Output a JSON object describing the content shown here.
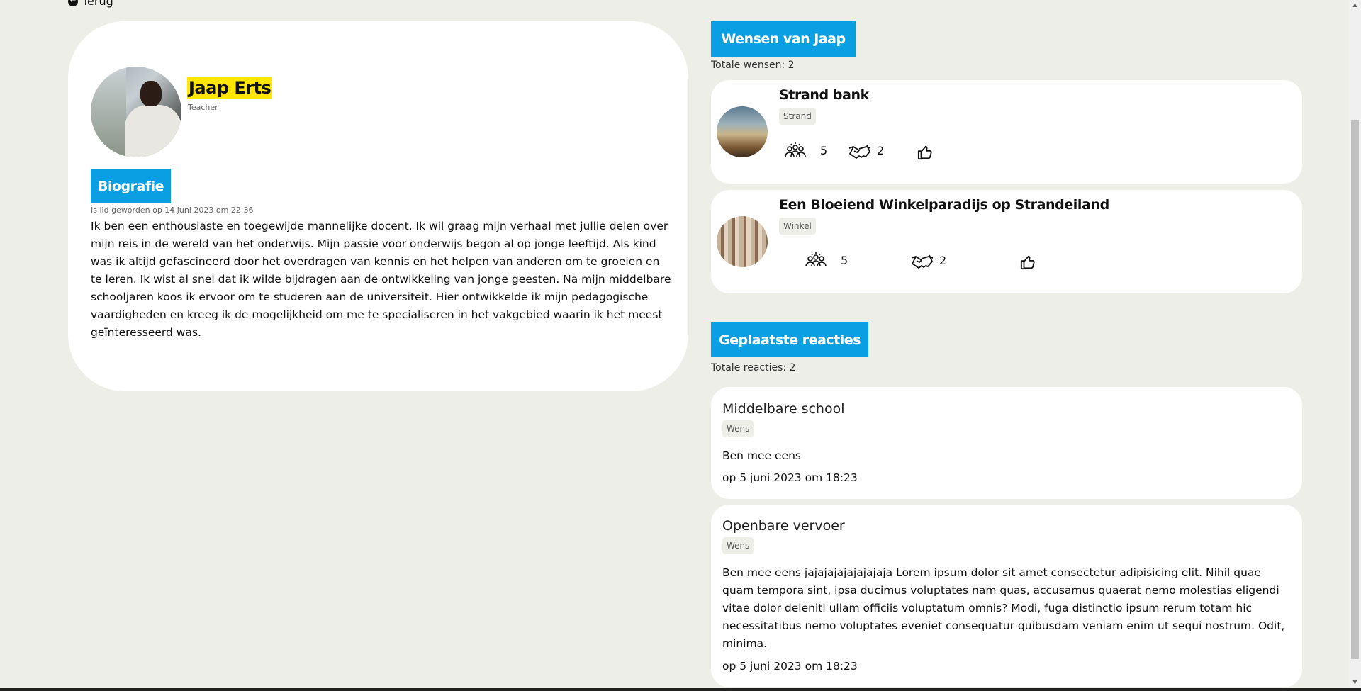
{
  "nav": {
    "back_label": "Terug"
  },
  "profile": {
    "name": "Jaap Erts",
    "role": "Teacher",
    "bio_heading": "Biografie",
    "member_since": "Is lid geworden op 14 juni 2023 om 22:36",
    "bio": "Ik ben een enthousiaste en toegewijde mannelijke docent. Ik wil graag mijn verhaal met jullie delen over mijn reis in de wereld van het onderwijs. Mijn passie voor onderwijs begon al op jonge leeftijd. Als kind was ik altijd gefascineerd door het overdragen van kennis en het helpen van anderen om te groeien en te leren. Ik wist al snel dat ik wilde bijdragen aan de ontwikkeling van jonge geesten. Na mijn middelbare schooljaren koos ik ervoor om te studeren aan de universiteit. Hier ontwikkelde ik mijn pedagogische vaardigheden en kreeg ik de mogelijkheid om me te specialiseren in het vakgebied waarin ik het meest geïnteresseerd was."
  },
  "wishes": {
    "heading": "Wensen van Jaap",
    "total": "Totale wensen: 2",
    "items": [
      {
        "title": "Strand bank",
        "tag": "Strand",
        "supporters": "5",
        "partners": "2"
      },
      {
        "title": "Een Bloeiend Winkelparadijs op Strandeiland",
        "tag": "Winkel",
        "supporters": "5",
        "partners": "2"
      }
    ]
  },
  "comments": {
    "heading": "Geplaatste reacties",
    "total": "Totale reacties: 2",
    "items": [
      {
        "title": "Middelbare school",
        "tag": "Wens",
        "body": "Ben mee eens",
        "date": "op 5 juni 2023 om 18:23"
      },
      {
        "title": "Openbare vervoer",
        "tag": "Wens",
        "body": "Ben mee eens jajajajajajajajaja Lorem ipsum dolor sit amet consectetur adipisicing elit. Nihil quae quam tempora sint, ipsa ducimus voluptates nam quas, accusamus quaerat nemo molestias eligendi vitae dolor deleniti ullam officiis voluptatum omnis? Modi, fuga distinctio ipsum rerum totam hic necessitatibus nemo voluptates eveniet consequatur quibusdam veniam enim ut sequi nostrum. Odit, minima.",
        "date": "op 5 juni 2023 om 18:23"
      }
    ]
  },
  "icons": {
    "back": "arrow-left-circle-icon",
    "supporters": "people-group-icon",
    "partners": "handshake-icon",
    "like": "thumbs-up-icon"
  },
  "colors": {
    "accent": "#0a9ee3",
    "highlight": "#ffe600",
    "background": "#eeeee9"
  }
}
